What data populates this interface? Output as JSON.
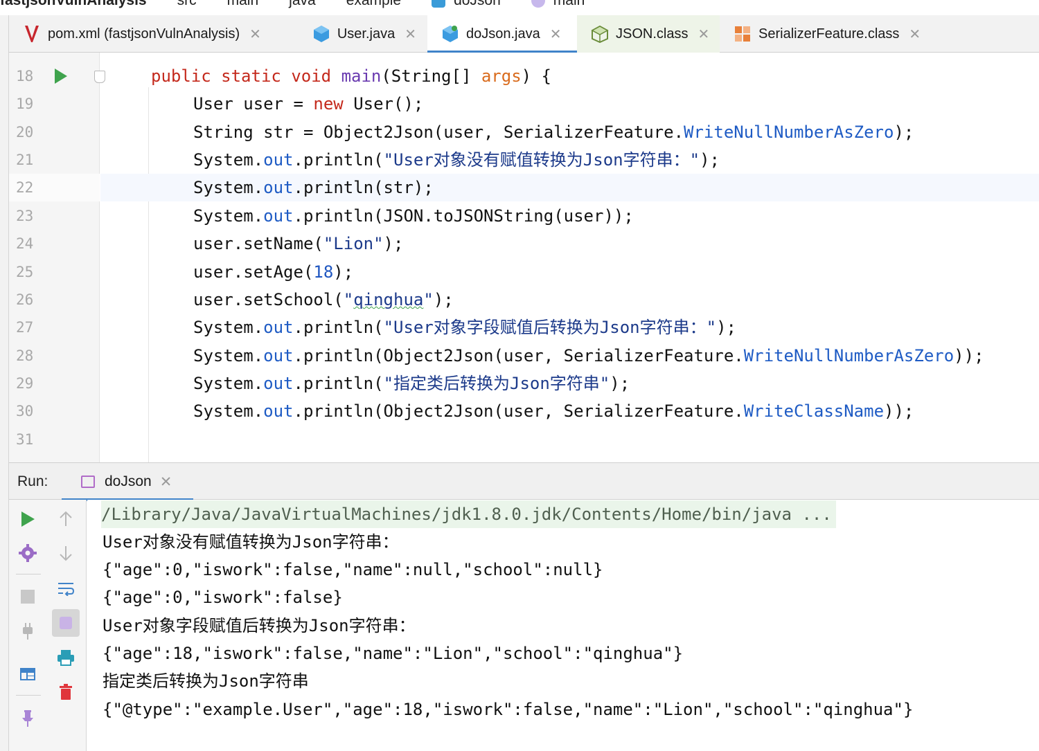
{
  "breadcrumb": [
    "fastjsonVulnAnalysis",
    "src",
    "main",
    "java",
    "example",
    "doJson",
    "main"
  ],
  "tabs": [
    {
      "label": "pom.xml (fastjsonVulnAnalysis)",
      "icon": "maven-icon",
      "active": false
    },
    {
      "label": "User.java",
      "icon": "java-class-icon",
      "active": false
    },
    {
      "label": "doJson.java",
      "icon": "java-class-icon",
      "active": true
    },
    {
      "label": "JSON.class",
      "icon": "class-file-icon",
      "active": false
    },
    {
      "label": "SerializerFeature.class",
      "icon": "enum-class-icon",
      "active": false
    }
  ],
  "editor": {
    "line_numbers": [
      "18",
      "19",
      "20",
      "21",
      "22",
      "23",
      "24",
      "25",
      "26",
      "27",
      "28",
      "29",
      "30",
      "31"
    ],
    "lines": {
      "l18": {
        "kw1": "public",
        "kw2": "static",
        "kw3": "void",
        "fn": "main",
        "a": "(String[] ",
        "param": "args",
        "b": ") {"
      },
      "l19": {
        "a": "User user = ",
        "kw": "new",
        "b": " User();"
      },
      "l20": {
        "a": "String str = Object2Json(user, SerializerFeature.",
        "field": "WriteNullNumberAsZero",
        "b": ");"
      },
      "l21": {
        "a": "System.",
        "field": "out",
        "b": ".println(",
        "str": "\"User对象没有赋值转换为Json字符串：\"",
        "c": ");"
      },
      "l22": {
        "a": "System.",
        "field": "out",
        "b": ".println(str);"
      },
      "l23": {
        "a": "System.",
        "field": "out",
        "b": ".println(JSON.toJSONString(user));"
      },
      "l24": {
        "a": "user.setName(",
        "str": "\"Lion\"",
        "b": ");"
      },
      "l25": {
        "a": "user.setAge(",
        "num": "18",
        "b": ");"
      },
      "l26": {
        "a": "user.setSchool(",
        "q1": "\"",
        "wavy": "qinghua",
        "q2": "\"",
        "b": ");"
      },
      "l27": {
        "a": "System.",
        "field": "out",
        "b": ".println(",
        "str": "\"User对象字段赋值后转换为Json字符串：\"",
        "c": ");"
      },
      "l28": {
        "a": "System.",
        "field": "out",
        "b": ".println(Object2Json(user, SerializerFeature.",
        "field2": "WriteNullNumberAsZero",
        "c": "));"
      },
      "l29": {
        "a": "System.",
        "field": "out",
        "b": ".println(",
        "str": "\"指定类后转换为Json字符串\"",
        "c": ");"
      },
      "l30": {
        "a": "System.",
        "field": "out",
        "b": ".println(Object2Json(user, SerializerFeature.",
        "field2": "WriteClassName",
        "c": "));"
      }
    }
  },
  "run_panel": {
    "label": "Run:",
    "tab_label": "doJson",
    "console_lines": [
      "/Library/Java/JavaVirtualMachines/jdk1.8.0.jdk/Contents/Home/bin/java ...",
      "User对象没有赋值转换为Json字符串：",
      "{\"age\":0,\"iswork\":false,\"name\":null,\"school\":null}",
      "{\"age\":0,\"iswork\":false}",
      "User对象字段赋值后转换为Json字符串：",
      "{\"age\":18,\"iswork\":false,\"name\":\"Lion\",\"school\":\"qinghua\"}",
      "指定类后转换为Json字符串",
      "{\"@type\":\"example.User\",\"age\":18,\"iswork\":false,\"name\":\"Lion\",\"school\":\"qinghua\"}"
    ],
    "tools": [
      "rerun-icon",
      "up-arrow-icon",
      "settings-icon",
      "down-arrow-icon",
      "stop-icon",
      "soft-wrap-icon",
      "plug-icon",
      "scroll-to-end-icon",
      "layout-icon",
      "print-icon",
      "pin-icon",
      "trash-icon"
    ]
  },
  "colors": {
    "accent": "#4083c9",
    "keyword": "#c4291c",
    "field": "#1e5bc4",
    "string": "#1c3a8a",
    "run_green": "#3fa34d"
  }
}
